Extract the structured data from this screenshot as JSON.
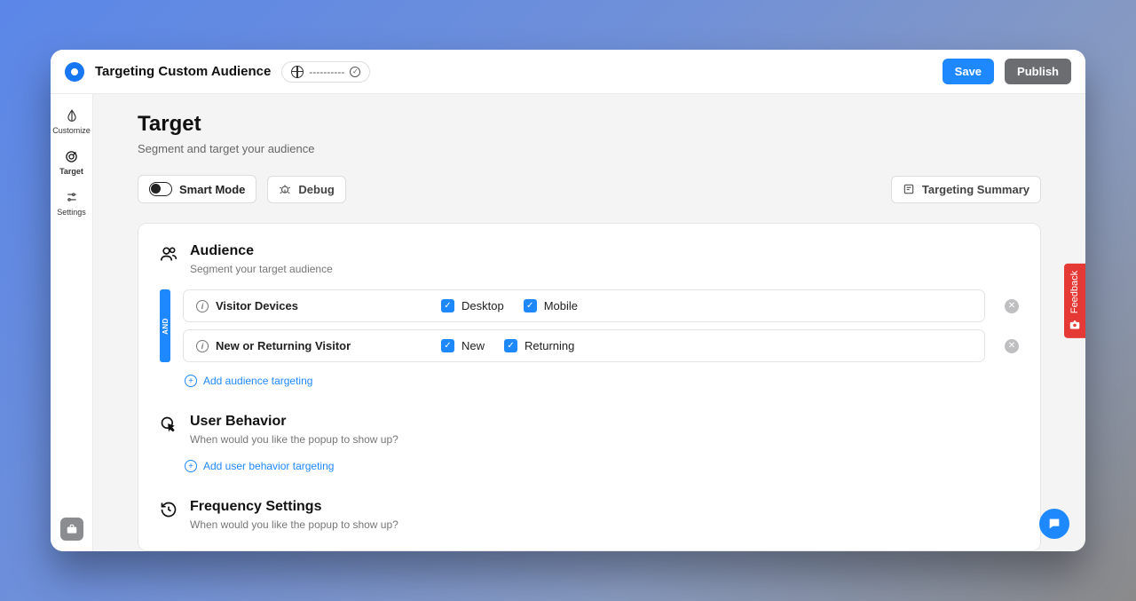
{
  "header": {
    "title": "Targeting Custom Audience",
    "status_text": "----------",
    "save_label": "Save",
    "publish_label": "Publish"
  },
  "sidebar": {
    "items": [
      {
        "label": "Customize"
      },
      {
        "label": "Target"
      },
      {
        "label": "Settings"
      }
    ]
  },
  "page": {
    "title": "Target",
    "subtitle": "Segment and target your audience"
  },
  "controls": {
    "smart_mode": "Smart Mode",
    "debug": "Debug",
    "summary": "Targeting Summary"
  },
  "audience": {
    "title": "Audience",
    "subtitle": "Segment your target audience",
    "and_label": "AND",
    "rules": [
      {
        "name": "Visitor Devices",
        "options": [
          "Desktop",
          "Mobile"
        ]
      },
      {
        "name": "New or Returning Visitor",
        "options": [
          "New",
          "Returning"
        ]
      }
    ],
    "add_label": "Add audience targeting"
  },
  "behavior": {
    "title": "User Behavior",
    "subtitle": "When would you like the popup to show up?",
    "add_label": "Add user behavior targeting"
  },
  "frequency": {
    "title": "Frequency Settings",
    "subtitle": "When would you like the popup to show up?"
  },
  "feedback": {
    "label": "Feedback"
  }
}
